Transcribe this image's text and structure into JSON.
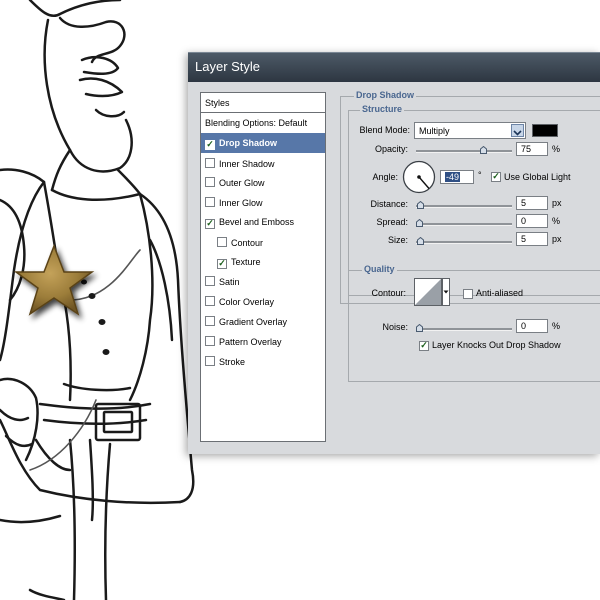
{
  "dialog": {
    "title": "Layer Style"
  },
  "left_panel": {
    "header": "Styles",
    "items": [
      {
        "label": "Blending Options: Default",
        "checkbox": false,
        "checked": false,
        "selected": false,
        "indent": false
      },
      {
        "label": "Drop Shadow",
        "checkbox": true,
        "checked": true,
        "selected": true,
        "indent": false
      },
      {
        "label": "Inner Shadow",
        "checkbox": true,
        "checked": false,
        "selected": false,
        "indent": false
      },
      {
        "label": "Outer Glow",
        "checkbox": true,
        "checked": false,
        "selected": false,
        "indent": false
      },
      {
        "label": "Inner Glow",
        "checkbox": true,
        "checked": false,
        "selected": false,
        "indent": false
      },
      {
        "label": "Bevel and Emboss",
        "checkbox": true,
        "checked": true,
        "selected": false,
        "indent": false
      },
      {
        "label": "Contour",
        "checkbox": true,
        "checked": false,
        "selected": false,
        "indent": true
      },
      {
        "label": "Texture",
        "checkbox": true,
        "checked": true,
        "selected": false,
        "indent": true
      },
      {
        "label": "Satin",
        "checkbox": true,
        "checked": false,
        "selected": false,
        "indent": false
      },
      {
        "label": "Color Overlay",
        "checkbox": true,
        "checked": false,
        "selected": false,
        "indent": false
      },
      {
        "label": "Gradient Overlay",
        "checkbox": true,
        "checked": false,
        "selected": false,
        "indent": false
      },
      {
        "label": "Pattern Overlay",
        "checkbox": true,
        "checked": false,
        "selected": false,
        "indent": false
      },
      {
        "label": "Stroke",
        "checkbox": true,
        "checked": false,
        "selected": false,
        "indent": false
      }
    ]
  },
  "drop_shadow": {
    "group_title": "Drop Shadow",
    "structure": {
      "title": "Structure",
      "blend_mode_label": "Blend Mode:",
      "blend_mode_value": "Multiply",
      "shadow_color": "#000000",
      "opacity_label": "Opacity:",
      "opacity_value": "75",
      "opacity_unit": "%",
      "angle_label": "Angle:",
      "angle_value": "-49",
      "angle_unit": "°",
      "use_global_light_label": "Use Global Light",
      "use_global_light_checked": true,
      "distance_label": "Distance:",
      "distance_value": "5",
      "distance_unit": "px",
      "spread_label": "Spread:",
      "spread_value": "0",
      "spread_unit": "%",
      "size_label": "Size:",
      "size_value": "5",
      "size_unit": "px"
    },
    "quality": {
      "title": "Quality",
      "contour_label": "Contour:",
      "anti_aliased_label": "Anti-aliased",
      "anti_aliased_checked": false,
      "noise_label": "Noise:",
      "noise_value": "0",
      "noise_unit": "%"
    },
    "knockout_label": "Layer Knocks Out Drop Shadow",
    "knockout_checked": true
  },
  "colors": {
    "selection": "#5777a8",
    "section_title": "#4a6790",
    "dialog_bg": "#d8dadd",
    "titlebar": "#3a4450",
    "star_fill": "#9c7d3a"
  }
}
